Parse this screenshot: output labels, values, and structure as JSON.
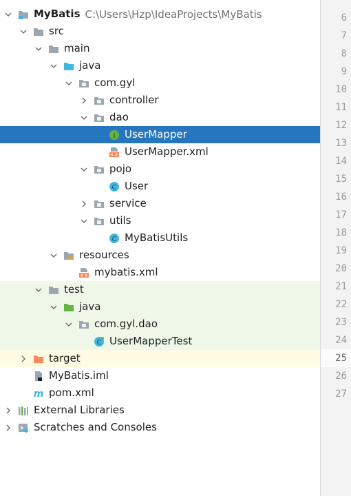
{
  "tree": {
    "rows": [
      {
        "label": "MyBatis",
        "path": "C:\\Users\\Hzp\\IdeaProjects\\MyBatis",
        "icon": "module-folder-icon",
        "expanded": true
      },
      {
        "label": "src",
        "icon": "folder-icon",
        "expanded": true
      },
      {
        "label": "main",
        "icon": "folder-icon",
        "expanded": true
      },
      {
        "label": "java",
        "icon": "source-root-folder-icon",
        "expanded": true
      },
      {
        "label": "com.gyl",
        "icon": "package-icon",
        "expanded": true
      },
      {
        "label": "controller",
        "icon": "package-icon",
        "expanded": false
      },
      {
        "label": "dao",
        "icon": "package-icon",
        "expanded": true
      },
      {
        "label": "UserMapper",
        "icon": "interface-icon",
        "selected": true
      },
      {
        "label": "UserMapper.xml",
        "icon": "xml-file-icon"
      },
      {
        "label": "pojo",
        "icon": "package-icon",
        "expanded": true
      },
      {
        "label": "User",
        "icon": "class-icon"
      },
      {
        "label": "service",
        "icon": "package-icon",
        "expanded": false
      },
      {
        "label": "utils",
        "icon": "package-icon",
        "expanded": true
      },
      {
        "label": "MyBatisUtils",
        "icon": "class-icon"
      },
      {
        "label": "resources",
        "icon": "resources-root-folder-icon",
        "expanded": true
      },
      {
        "label": "mybatis.xml",
        "icon": "xml-file-icon"
      },
      {
        "label": "test",
        "icon": "folder-icon",
        "expanded": true
      },
      {
        "label": "java",
        "icon": "test-root-folder-icon",
        "expanded": true
      },
      {
        "label": "com.gyl.dao",
        "icon": "package-icon",
        "expanded": true
      },
      {
        "label": "UserMapperTest",
        "icon": "test-class-icon"
      },
      {
        "label": "target",
        "icon": "excluded-folder-icon",
        "expanded": false
      },
      {
        "label": "MyBatis.iml",
        "icon": "iml-file-icon"
      },
      {
        "label": "pom.xml",
        "icon": "maven-icon"
      },
      {
        "label": "External Libraries",
        "icon": "libraries-icon",
        "expanded": false
      },
      {
        "label": "Scratches and Consoles",
        "icon": "scratches-icon",
        "expanded": false
      }
    ]
  },
  "gutter": {
    "line_numbers": [
      "6",
      "7",
      "8",
      "9",
      "10",
      "11",
      "12",
      "13",
      "14",
      "15",
      "16",
      "17",
      "18",
      "19",
      "20",
      "21",
      "22",
      "23",
      "24",
      "25",
      "26",
      "27"
    ],
    "current_line": "25"
  },
  "colors": {
    "selection": "#2675bf",
    "test_background": "#eff7e9",
    "excluded_background": "#fffce3"
  }
}
